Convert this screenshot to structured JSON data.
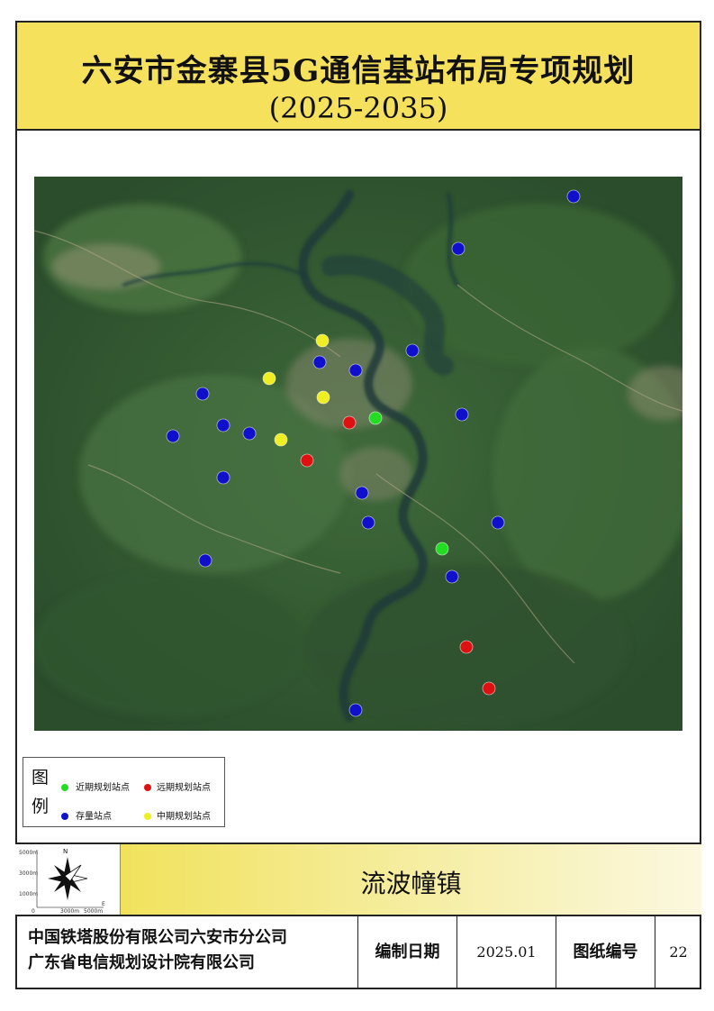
{
  "title": {
    "main": "六安市金寨县5G通信基站布局专项规划",
    "sub": "(2025-2035)"
  },
  "colors": {
    "title_bg": "#f6e15c",
    "near_term": "#22dd22",
    "long_term": "#dd1111",
    "existing": "#1010cc",
    "mid_term": "#eeee22"
  },
  "legend": {
    "title": "图例",
    "items": [
      {
        "label": "近期规划站点",
        "color": "#22dd22"
      },
      {
        "label": "远期规划站点",
        "color": "#dd1111"
      },
      {
        "label": "存量站点",
        "color": "#1010cc"
      },
      {
        "label": "中期规划站点",
        "color": "#eeee22"
      }
    ]
  },
  "scale": {
    "north": "N",
    "y_labels": [
      "5000m",
      "3000m",
      "1000m",
      "0"
    ],
    "x_labels": [
      "3000m",
      "5000m"
    ],
    "x_end": "E"
  },
  "district": "流波幢镇",
  "footer": {
    "org_line1": "中国铁塔股份有限公司六安市分公司",
    "org_line2": "广东省电信规划设计院有限公司",
    "date_label": "编制日期",
    "date_value": "2025.01",
    "sheet_label": "图纸编号",
    "sheet_value": "22"
  }
}
